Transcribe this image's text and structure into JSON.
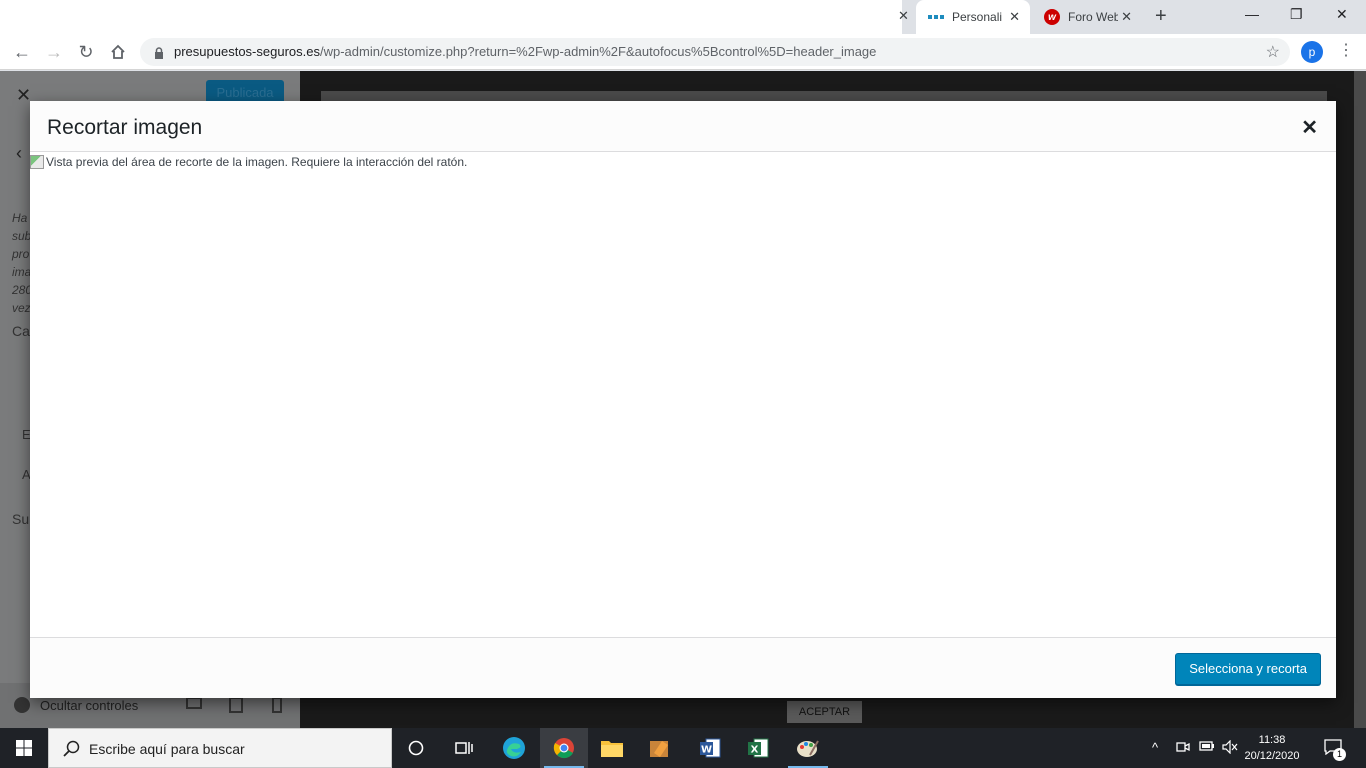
{
  "browser": {
    "tabs": [
      {
        "title": "Personali",
        "favicon": "wordpress-dots-icon",
        "active": true
      },
      {
        "title": "Foro Web",
        "favicon": "w-logo-icon",
        "active": false
      }
    ],
    "url_domain": "presupuestos-seguros.es",
    "url_path": "/wp-admin/customize.php?return=%2Fwp-admin%2F&autofocus%5Bcontrol%5D=header_image",
    "profile_initial": "p",
    "accent": "#1a73e8"
  },
  "customizer": {
    "publish_label": "Publicada",
    "help_lines": [
      "Ha",
      "sub",
      "pro",
      "ima",
      "280",
      "vez"
    ],
    "fragments": [
      "Ca",
      "E",
      "A",
      "Sub"
    ],
    "hide_controls_label": "Ocultar controles",
    "aceptar_label": "ACEPTAR"
  },
  "modal": {
    "title": "Recortar imagen",
    "image_alt": "Vista previa del área de recorte de la imagen. Requiere la interacción del ratón.",
    "crop_button": "Selecciona y recorta",
    "button_color": "#0085ba"
  },
  "taskbar": {
    "search_placeholder": "Escribe aquí para buscar",
    "time": "11:38",
    "date": "20/12/2020",
    "notification_count": "1"
  }
}
